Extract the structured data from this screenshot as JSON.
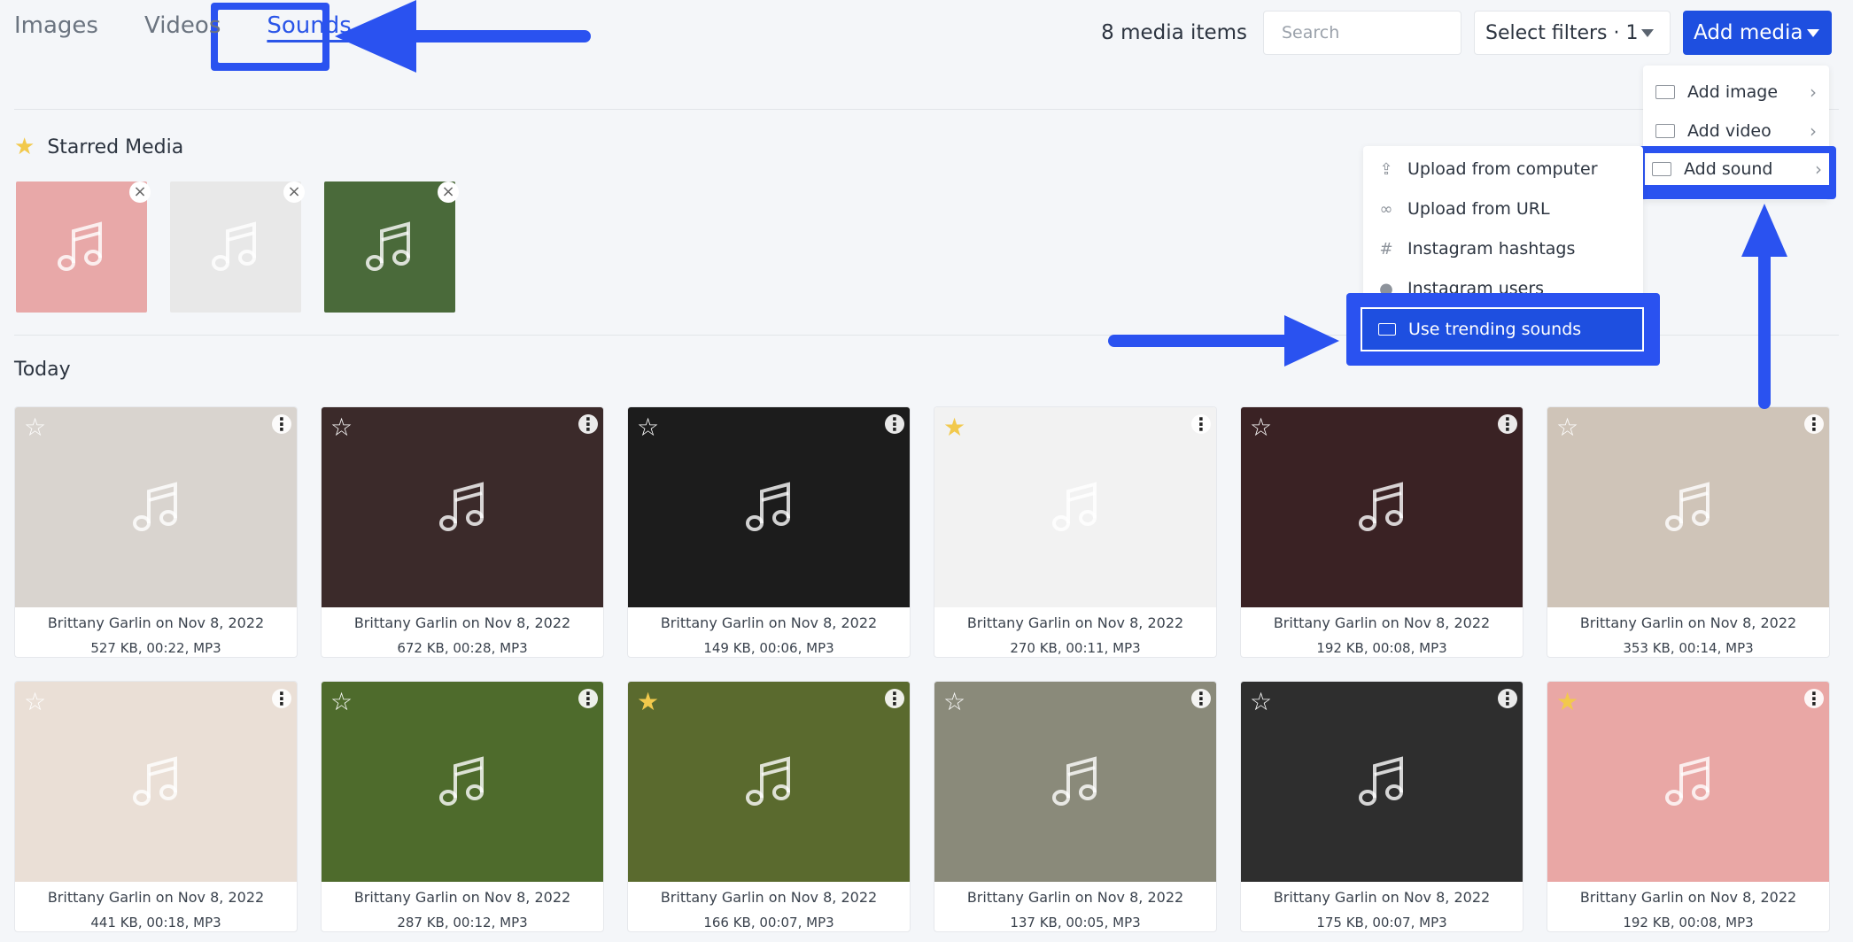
{
  "tabs": [
    {
      "label": "Images",
      "active": false
    },
    {
      "label": "Videos",
      "active": false
    },
    {
      "label": "Sounds",
      "active": true
    }
  ],
  "header": {
    "media_count": "8 media items",
    "search_placeholder": "Search",
    "filter_label": "Select filters · 1",
    "add_media_label": "Add media"
  },
  "add_media_menu": {
    "items": [
      {
        "label": "Add image",
        "icon": "camera-icon"
      },
      {
        "label": "Add video",
        "icon": "video-icon"
      },
      {
        "label": "Add sound",
        "icon": "sound-icon",
        "highlighted": true
      }
    ]
  },
  "sound_submenu": {
    "items": [
      {
        "label": "Upload from computer",
        "icon": "upload-icon"
      },
      {
        "label": "Upload from URL",
        "icon": "link-icon"
      },
      {
        "label": "Instagram hashtags",
        "icon": "hashtag-icon"
      },
      {
        "label": "Instagram users",
        "icon": "user-icon"
      },
      {
        "label": "Use trending sounds",
        "icon": "sound-icon",
        "highlighted": true
      }
    ]
  },
  "starred": {
    "title": "Starred Media",
    "items": [
      {
        "bg": "#e8a8a8"
      },
      {
        "bg": "#e8e8e8"
      },
      {
        "bg": "#4a6a3a"
      }
    ]
  },
  "today_label": "Today",
  "cards": [
    {
      "author": "Brittany Garlin on Nov 8, 2022",
      "info": "527 KB, 00:22, MP3",
      "starred": false,
      "bg": "#d9d4cf"
    },
    {
      "author": "Brittany Garlin on Nov 8, 2022",
      "info": "672 KB, 00:28, MP3",
      "starred": false,
      "bg": "#3b2a2a"
    },
    {
      "author": "Brittany Garlin on Nov 8, 2022",
      "info": "149 KB, 00:06, MP3",
      "starred": false,
      "bg": "#1c1c1c"
    },
    {
      "author": "Brittany Garlin on Nov 8, 2022",
      "info": "270 KB, 00:11, MP3",
      "starred": true,
      "bg": "#f2f2f2"
    },
    {
      "author": "Brittany Garlin on Nov 8, 2022",
      "info": "192 KB, 00:08, MP3",
      "starred": false,
      "bg": "#3a2224"
    },
    {
      "author": "Brittany Garlin on Nov 8, 2022",
      "info": "353 KB, 00:14, MP3",
      "starred": false,
      "bg": "#cfc4b8"
    },
    {
      "author": "Brittany Garlin on Nov 8, 2022",
      "info": "441 KB, 00:18, MP3",
      "starred": false,
      "bg": "#eadfd6"
    },
    {
      "author": "Brittany Garlin on Nov 8, 2022",
      "info": "287 KB, 00:12, MP3",
      "starred": false,
      "bg": "#4e6b2c"
    },
    {
      "author": "Brittany Garlin on Nov 8, 2022",
      "info": "166 KB, 00:07, MP3",
      "starred": true,
      "bg": "#5a6a2e"
    },
    {
      "author": "Brittany Garlin on Nov 8, 2022",
      "info": "137 KB, 00:05, MP3",
      "starred": false,
      "bg": "#8a8a7a"
    },
    {
      "author": "Brittany Garlin on Nov 8, 2022",
      "info": "175 KB, 00:07, MP3",
      "starred": false,
      "bg": "#2e2e2e"
    },
    {
      "author": "Brittany Garlin on Nov 8, 2022",
      "info": "192 KB, 00:08, MP3",
      "starred": true,
      "bg": "#e9a7a5"
    }
  ],
  "colors": {
    "accent": "#1e4fe0",
    "annotation": "#2a52f0",
    "star_filled": "#f2c94c"
  }
}
